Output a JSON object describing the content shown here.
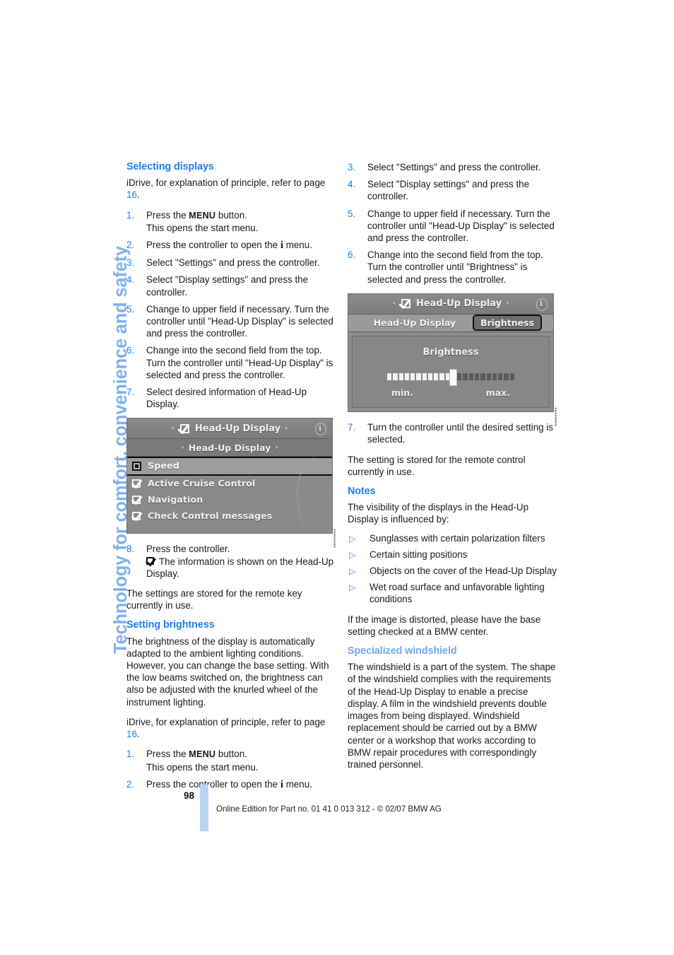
{
  "sidebar": {
    "chapter_label": "Technology for comfort, convenience and safety",
    "color": "#7fb2ef"
  },
  "left_column": {
    "heading_selecting": "Selecting displays",
    "intro_idrive_a": "iDrive, for explanation of principle, refer to page ",
    "intro_page_ref": "16",
    "intro_idrive_b": ".",
    "steps": [
      {
        "num": "1.",
        "pre": "Press the ",
        "menu": "MENU",
        "post": " button.",
        "second_line": "This opens the start menu."
      },
      {
        "num": "2.",
        "pre": "Press the controller to open the ",
        "glyph": "i",
        "post": " menu.",
        "second_line": ""
      },
      {
        "num": "3.",
        "pre": "Select \"Settings\" and press the controller.",
        "second_line": ""
      },
      {
        "num": "4.",
        "pre": "Select \"Display settings\" and press the controller.",
        "second_line": ""
      },
      {
        "num": "5.",
        "pre": "Change to upper field if necessary. Turn the controller until \"Head-Up Display\" is selected and press the controller.",
        "second_line": ""
      },
      {
        "num": "6.",
        "pre": "Change into the second field from the top. Turn the controller until \"Head-Up Display\" is selected and press the controller.",
        "second_line": ""
      },
      {
        "num": "7.",
        "pre": "Select desired information of Head-Up Display.",
        "second_line": ""
      }
    ],
    "figure_displays": {
      "topbar_title": "Head-Up Display",
      "arrow_left": "‹",
      "arrow_right": "›",
      "info_letter": "i",
      "subbar_title": "Head-Up Display",
      "rows": [
        {
          "label": "Speed",
          "icon": "filled-box-icon",
          "selected": true
        },
        {
          "label": "Active Cruise Control",
          "icon": "checkmark-icon",
          "selected": false
        },
        {
          "label": "Navigation",
          "icon": "checkmark-icon",
          "selected": false
        },
        {
          "label": "Check Control messages",
          "icon": "checkmark-icon",
          "selected": false
        }
      ]
    },
    "step8": {
      "num": "8.",
      "line1": "Press the controller.",
      "line2": "The information is shown on the Head-Up Display."
    },
    "para_stored": "The settings are stored for the remote key currently in use.",
    "heading_brightness": "Setting brightness",
    "para_brightness": "The brightness of the display is automatically adapted to the ambient lighting conditions. However, you can change the base setting. With the low beams switched on, the brightness can also be adjusted with the knurled wheel of the instrument lighting.",
    "intro_idrive2_a": "iDrive, for explanation of principle, refer to page ",
    "intro_page_ref2": "16",
    "intro_idrive2_b": ".",
    "steps2": [
      {
        "num": "1.",
        "pre": "Press the ",
        "menu": "MENU",
        "post": " button.",
        "second_line": "This opens the start menu."
      },
      {
        "num": "2.",
        "pre": "Press the controller to open the ",
        "glyph": "i",
        "post": " menu.",
        "second_line": ""
      }
    ]
  },
  "right_column": {
    "steps": [
      {
        "num": "3.",
        "text": "Select \"Settings\" and press the controller."
      },
      {
        "num": "4.",
        "text": "Select \"Display settings\" and press the controller."
      },
      {
        "num": "5.",
        "text": "Change to upper field if necessary. Turn the controller until \"Head-Up Display\" is selected and press the controller."
      },
      {
        "num": "6.",
        "text": "Change into the second field from the top. Turn the controller until \"Brightness\" is selected and press the controller."
      }
    ],
    "figure_brightness": {
      "topbar_title": "Head-Up Display",
      "arrow_left": "‹",
      "arrow_right": "›",
      "info_letter": "i",
      "tab_unselected": "Head-Up Display",
      "tab_selected": "Brightness",
      "panel_title": "Brightness",
      "slider_segments_total": 22,
      "slider_segments_on": 11,
      "min_label": "min.",
      "max_label": "max."
    },
    "step7": {
      "num": "7.",
      "text": "Turn the controller until the desired setting is selected."
    },
    "para_stored": "The setting is stored for the remote control currently in use.",
    "heading_notes": "Notes",
    "para_notes_intro": "The visibility of the displays in the Head-Up Display is influenced by:",
    "bullets": [
      "Sunglasses with certain polarization filters",
      "Certain sitting positions",
      "Objects on the cover of the Head-Up Display",
      "Wet road surface and unfavorable lighting conditions"
    ],
    "para_distorted": "If the image is distorted, please have the base setting checked at a BMW center.",
    "heading_windshield": "Specialized windshield",
    "para_windshield": "The windshield is a part of the system. The shape of the windshield complies with the requirements of the Head-Up Display to enable a precise display. A film in the windshield prevents double images from being displayed. Windshield replacement should be carried out by a BMW center or a workshop that works according to BMW repair procedures with correspondingly trained personnel."
  },
  "footer": {
    "page_number": "98",
    "edition_text": "Online Edition for Part no. 01 41 0 013 312 - © 02/07 BMW AG"
  }
}
